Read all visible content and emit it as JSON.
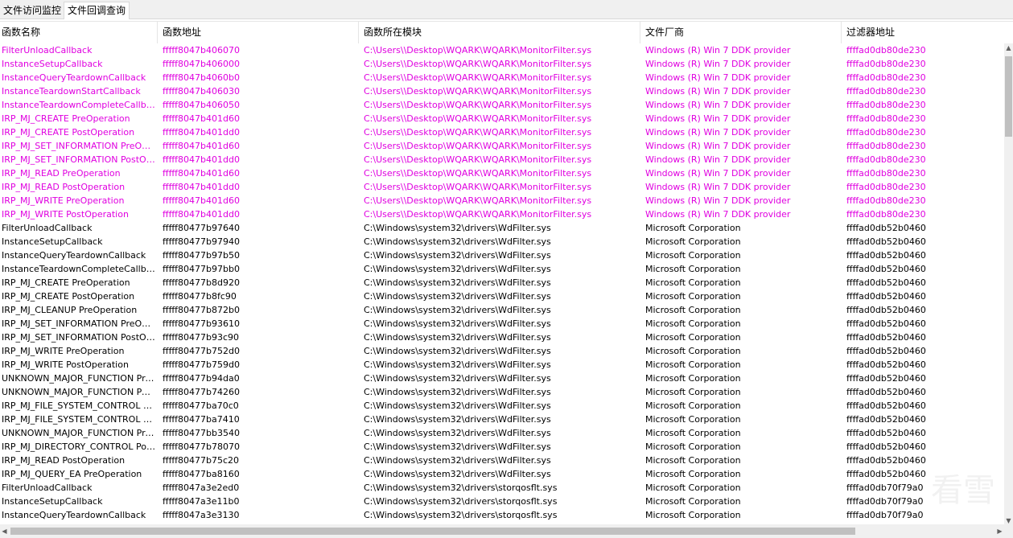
{
  "tabs": [
    "文件访问监控",
    "文件回调查询"
  ],
  "columns": [
    "函数名称",
    "函数地址",
    "函数所在模块",
    "文件厂商",
    "过滤器地址"
  ],
  "highlight_color": "#e000e0",
  "watermark": "看雪",
  "rows": [
    {
      "hl": true,
      "cells": [
        "FilterUnloadCallback",
        "fffff8047b406070",
        "C:\\Users\\\\Desktop\\WQARK\\WQARK\\MonitorFilter.sys",
        "Windows (R) Win 7 DDK provider",
        "ffffad0db80de230"
      ]
    },
    {
      "hl": true,
      "cells": [
        "InstanceSetupCallback",
        "fffff8047b406000",
        "C:\\Users\\\\Desktop\\WQARK\\WQARK\\MonitorFilter.sys",
        "Windows (R) Win 7 DDK provider",
        "ffffad0db80de230"
      ]
    },
    {
      "hl": true,
      "cells": [
        "InstanceQueryTeardownCallback",
        "fffff8047b4060b0",
        "C:\\Users\\\\Desktop\\WQARK\\WQARK\\MonitorFilter.sys",
        "Windows (R) Win 7 DDK provider",
        "ffffad0db80de230"
      ]
    },
    {
      "hl": true,
      "cells": [
        "InstanceTeardownStartCallback",
        "fffff8047b406030",
        "C:\\Users\\\\Desktop\\WQARK\\WQARK\\MonitorFilter.sys",
        "Windows (R) Win 7 DDK provider",
        "ffffad0db80de230"
      ]
    },
    {
      "hl": true,
      "cells": [
        "InstanceTeardownCompleteCallback",
        "fffff8047b406050",
        "C:\\Users\\\\Desktop\\WQARK\\WQARK\\MonitorFilter.sys",
        "Windows (R) Win 7 DDK provider",
        "ffffad0db80de230"
      ]
    },
    {
      "hl": true,
      "cells": [
        "IRP_MJ_CREATE PreOperation",
        "fffff8047b401d60",
        "C:\\Users\\\\Desktop\\WQARK\\WQARK\\MonitorFilter.sys",
        "Windows (R) Win 7 DDK provider",
        "ffffad0db80de230"
      ]
    },
    {
      "hl": true,
      "cells": [
        "IRP_MJ_CREATE PostOperation",
        "fffff8047b401dd0",
        "C:\\Users\\\\Desktop\\WQARK\\WQARK\\MonitorFilter.sys",
        "Windows (R) Win 7 DDK provider",
        "ffffad0db80de230"
      ]
    },
    {
      "hl": true,
      "cells": [
        "IRP_MJ_SET_INFORMATION PreOpe...",
        "fffff8047b401d60",
        "C:\\Users\\\\Desktop\\WQARK\\WQARK\\MonitorFilter.sys",
        "Windows (R) Win 7 DDK provider",
        "ffffad0db80de230"
      ]
    },
    {
      "hl": true,
      "cells": [
        "IRP_MJ_SET_INFORMATION PostOp...",
        "fffff8047b401dd0",
        "C:\\Users\\\\Desktop\\WQARK\\WQARK\\MonitorFilter.sys",
        "Windows (R) Win 7 DDK provider",
        "ffffad0db80de230"
      ]
    },
    {
      "hl": true,
      "cells": [
        "IRP_MJ_READ PreOperation",
        "fffff8047b401d60",
        "C:\\Users\\\\Desktop\\WQARK\\WQARK\\MonitorFilter.sys",
        "Windows (R) Win 7 DDK provider",
        "ffffad0db80de230"
      ]
    },
    {
      "hl": true,
      "cells": [
        "IRP_MJ_READ PostOperation",
        "fffff8047b401dd0",
        "C:\\Users\\\\Desktop\\WQARK\\WQARK\\MonitorFilter.sys",
        "Windows (R) Win 7 DDK provider",
        "ffffad0db80de230"
      ]
    },
    {
      "hl": true,
      "cells": [
        "IRP_MJ_WRITE PreOperation",
        "fffff8047b401d60",
        "C:\\Users\\\\Desktop\\WQARK\\WQARK\\MonitorFilter.sys",
        "Windows (R) Win 7 DDK provider",
        "ffffad0db80de230"
      ]
    },
    {
      "hl": true,
      "cells": [
        "IRP_MJ_WRITE PostOperation",
        "fffff8047b401dd0",
        "C:\\Users\\\\Desktop\\WQARK\\WQARK\\MonitorFilter.sys",
        "Windows (R) Win 7 DDK provider",
        "ffffad0db80de230"
      ]
    },
    {
      "hl": false,
      "cells": [
        "FilterUnloadCallback",
        "fffff80477b97640",
        "C:\\Windows\\system32\\drivers\\WdFilter.sys",
        "Microsoft Corporation",
        "ffffad0db52b0460"
      ]
    },
    {
      "hl": false,
      "cells": [
        "InstanceSetupCallback",
        "fffff80477b97940",
        "C:\\Windows\\system32\\drivers\\WdFilter.sys",
        "Microsoft Corporation",
        "ffffad0db52b0460"
      ]
    },
    {
      "hl": false,
      "cells": [
        "InstanceQueryTeardownCallback",
        "fffff80477b97b50",
        "C:\\Windows\\system32\\drivers\\WdFilter.sys",
        "Microsoft Corporation",
        "ffffad0db52b0460"
      ]
    },
    {
      "hl": false,
      "cells": [
        "InstanceTeardownCompleteCallback",
        "fffff80477b97bb0",
        "C:\\Windows\\system32\\drivers\\WdFilter.sys",
        "Microsoft Corporation",
        "ffffad0db52b0460"
      ]
    },
    {
      "hl": false,
      "cells": [
        "IRP_MJ_CREATE PreOperation",
        "fffff80477b8d920",
        "C:\\Windows\\system32\\drivers\\WdFilter.sys",
        "Microsoft Corporation",
        "ffffad0db52b0460"
      ]
    },
    {
      "hl": false,
      "cells": [
        "IRP_MJ_CREATE PostOperation",
        "fffff80477b8fc90",
        "C:\\Windows\\system32\\drivers\\WdFilter.sys",
        "Microsoft Corporation",
        "ffffad0db52b0460"
      ]
    },
    {
      "hl": false,
      "cells": [
        "IRP_MJ_CLEANUP PreOperation",
        "fffff80477b872b0",
        "C:\\Windows\\system32\\drivers\\WdFilter.sys",
        "Microsoft Corporation",
        "ffffad0db52b0460"
      ]
    },
    {
      "hl": false,
      "cells": [
        "IRP_MJ_SET_INFORMATION PreOpe...",
        "fffff80477b93610",
        "C:\\Windows\\system32\\drivers\\WdFilter.sys",
        "Microsoft Corporation",
        "ffffad0db52b0460"
      ]
    },
    {
      "hl": false,
      "cells": [
        "IRP_MJ_SET_INFORMATION PostOp...",
        "fffff80477b93c90",
        "C:\\Windows\\system32\\drivers\\WdFilter.sys",
        "Microsoft Corporation",
        "ffffad0db52b0460"
      ]
    },
    {
      "hl": false,
      "cells": [
        "IRP_MJ_WRITE PreOperation",
        "fffff80477b752d0",
        "C:\\Windows\\system32\\drivers\\WdFilter.sys",
        "Microsoft Corporation",
        "ffffad0db52b0460"
      ]
    },
    {
      "hl": false,
      "cells": [
        "IRP_MJ_WRITE PostOperation",
        "fffff80477b759d0",
        "C:\\Windows\\system32\\drivers\\WdFilter.sys",
        "Microsoft Corporation",
        "ffffad0db52b0460"
      ]
    },
    {
      "hl": false,
      "cells": [
        "UNKNOWN_MAJOR_FUNCTION PreO...",
        "fffff80477b94da0",
        "C:\\Windows\\system32\\drivers\\WdFilter.sys",
        "Microsoft Corporation",
        "ffffad0db52b0460"
      ]
    },
    {
      "hl": false,
      "cells": [
        "UNKNOWN_MAJOR_FUNCTION Post...",
        "fffff80477b74260",
        "C:\\Windows\\system32\\drivers\\WdFilter.sys",
        "Microsoft Corporation",
        "ffffad0db52b0460"
      ]
    },
    {
      "hl": false,
      "cells": [
        "IRP_MJ_FILE_SYSTEM_CONTROL Pre...",
        "fffff80477ba70c0",
        "C:\\Windows\\system32\\drivers\\WdFilter.sys",
        "Microsoft Corporation",
        "ffffad0db52b0460"
      ]
    },
    {
      "hl": false,
      "cells": [
        "IRP_MJ_FILE_SYSTEM_CONTROL Po...",
        "fffff80477ba7410",
        "C:\\Windows\\system32\\drivers\\WdFilter.sys",
        "Microsoft Corporation",
        "ffffad0db52b0460"
      ]
    },
    {
      "hl": false,
      "cells": [
        "UNKNOWN_MAJOR_FUNCTION PreO...",
        "fffff80477bb3540",
        "C:\\Windows\\system32\\drivers\\WdFilter.sys",
        "Microsoft Corporation",
        "ffffad0db52b0460"
      ]
    },
    {
      "hl": false,
      "cells": [
        "IRP_MJ_DIRECTORY_CONTROL Post...",
        "fffff80477b78070",
        "C:\\Windows\\system32\\drivers\\WdFilter.sys",
        "Microsoft Corporation",
        "ffffad0db52b0460"
      ]
    },
    {
      "hl": false,
      "cells": [
        "IRP_MJ_READ PostOperation",
        "fffff80477b75c20",
        "C:\\Windows\\system32\\drivers\\WdFilter.sys",
        "Microsoft Corporation",
        "ffffad0db52b0460"
      ]
    },
    {
      "hl": false,
      "cells": [
        "IRP_MJ_QUERY_EA PreOperation",
        "fffff80477ba8160",
        "C:\\Windows\\system32\\drivers\\WdFilter.sys",
        "Microsoft Corporation",
        "ffffad0db52b0460"
      ]
    },
    {
      "hl": false,
      "cells": [
        "FilterUnloadCallback",
        "fffff8047a3e2ed0",
        "C:\\Windows\\system32\\drivers\\storqosflt.sys",
        "Microsoft Corporation",
        "ffffad0db70f79a0"
      ]
    },
    {
      "hl": false,
      "cells": [
        "InstanceSetupCallback",
        "fffff8047a3e11b0",
        "C:\\Windows\\system32\\drivers\\storqosflt.sys",
        "Microsoft Corporation",
        "ffffad0db70f79a0"
      ]
    },
    {
      "hl": false,
      "cells": [
        "InstanceQueryTeardownCallback",
        "fffff8047a3e3130",
        "C:\\Windows\\system32\\drivers\\storqosflt.sys",
        "Microsoft Corporation",
        "ffffad0db70f79a0"
      ]
    }
  ]
}
